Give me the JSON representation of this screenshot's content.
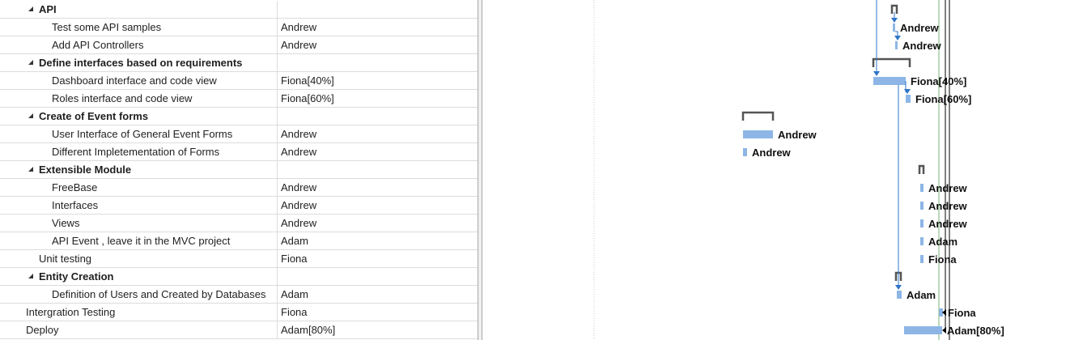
{
  "colors": {
    "bar": "#8db6e6",
    "summary_bracket": "#555555",
    "link": "#2e75c9",
    "current_date": "#000000",
    "status_date": "#78b478"
  },
  "tasks": [
    {
      "name": "API",
      "resource": "",
      "summary": true,
      "level": 1,
      "collapsed": false
    },
    {
      "name": "Test some API samples",
      "resource": "Andrew",
      "summary": false,
      "level": 2
    },
    {
      "name": "Add API Controllers",
      "resource": "Andrew",
      "summary": false,
      "level": 2
    },
    {
      "name": "Define interfaces based on requirements",
      "resource": "",
      "summary": true,
      "level": 1,
      "collapsed": false
    },
    {
      "name": "Dashboard  interface and code view",
      "resource": "Fiona[40%]",
      "summary": false,
      "level": 2
    },
    {
      "name": "Roles interface and code view",
      "resource": "Fiona[60%]",
      "summary": false,
      "level": 2
    },
    {
      "name": "Create of  Event forms",
      "resource": "",
      "summary": true,
      "level": 1,
      "collapsed": false
    },
    {
      "name": "User Interface of General Event Forms",
      "resource": "Andrew",
      "summary": false,
      "level": 2
    },
    {
      "name": "Different Impletementation of Forms",
      "resource": "Andrew",
      "summary": false,
      "level": 2
    },
    {
      "name": "Extensible Module",
      "resource": "",
      "summary": true,
      "level": 1,
      "collapsed": false
    },
    {
      "name": "FreeBase",
      "resource": "Andrew",
      "summary": false,
      "level": 2
    },
    {
      "name": "Interfaces",
      "resource": "Andrew",
      "summary": false,
      "level": 2
    },
    {
      "name": "Views",
      "resource": "Andrew",
      "summary": false,
      "level": 2
    },
    {
      "name": "API Event , leave it in the MVC project",
      "resource": "Adam",
      "summary": false,
      "level": 2
    },
    {
      "name": "Unit testing",
      "resource": "Fiona",
      "summary": false,
      "level": 1
    },
    {
      "name": "Entity Creation",
      "resource": "",
      "summary": true,
      "level": 1,
      "collapsed": false
    },
    {
      "name": "Definition of Users and Created by Databases",
      "resource": "Adam",
      "summary": false,
      "level": 2
    },
    {
      "name": "Intergration Testing",
      "resource": "Fiona",
      "summary": false,
      "level": 0
    },
    {
      "name": "Deploy",
      "resource": "Adam[80%]",
      "summary": false,
      "level": 0
    }
  ]
}
